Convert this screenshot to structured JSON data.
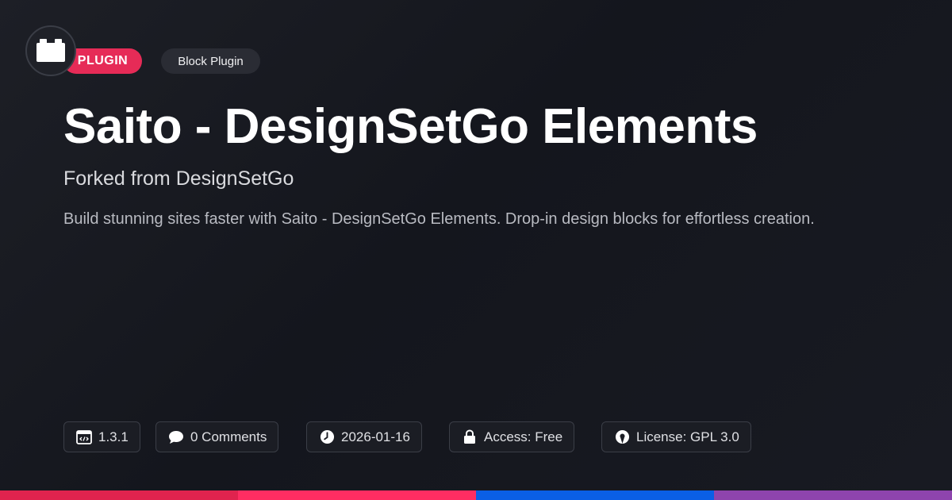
{
  "badges": {
    "type": "PLUGIN",
    "category": "Block Plugin"
  },
  "title": "Saito - DesignSetGo Elements",
  "subtitle": "Forked from DesignSetGo",
  "description": "Build stunning sites faster with Saito - DesignSetGo Elements. Drop-in design blocks for effortless creation.",
  "meta": {
    "version": "1.3.1",
    "comments": "0 Comments",
    "date": "2026-01-16",
    "access": "Access: Free",
    "license": "License: GPL 3.0"
  },
  "icons": {
    "logo": "lego-brick-icon",
    "version": "code-window-icon",
    "comments": "speech-bubble-icon",
    "date": "clock-icon",
    "access": "lock-icon",
    "license": "open-source-icon"
  },
  "colors": {
    "plugin_badge": "#e62b57",
    "bar_1": "#e0234e",
    "bar_2": "#ff2d62",
    "bar_3": "#0a5fe6",
    "bar_4": "#8e44ad"
  }
}
